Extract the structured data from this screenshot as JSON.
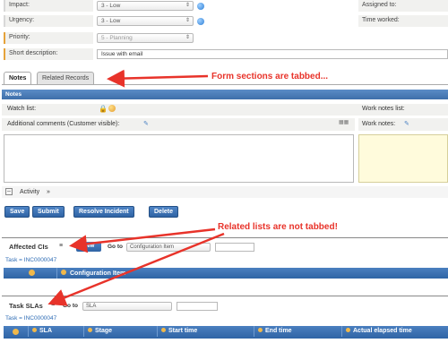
{
  "form": {
    "impact": {
      "label": "Impact:",
      "value": "3 - Low"
    },
    "urgency": {
      "label": "Urgency:",
      "value": "3 - Low"
    },
    "priority": {
      "label": "Priority:",
      "value": "5 - Planning"
    },
    "short_description": {
      "label": "Short description:",
      "value": "Issue with email"
    },
    "assigned_to": {
      "label": "Assigned to:"
    },
    "time_worked": {
      "label": "Time worked:"
    }
  },
  "tabs": [
    {
      "label": "Notes"
    },
    {
      "label": "Related Records"
    }
  ],
  "notes_section": {
    "header": "Notes",
    "watch_list_label": "Watch list:",
    "additional_comments_label": "Additional comments (Customer visible):",
    "work_notes_list_label": "Work notes list:",
    "work_notes_label": "Work notes:"
  },
  "activity": {
    "label": "Activity",
    "chevron": "»"
  },
  "buttons": {
    "save": "Save",
    "submit": "Submit",
    "resolve": "Resolve Incident",
    "delete": "Delete"
  },
  "annotations": {
    "tabbed": "Form sections are tabbed...",
    "not_tabbed": "Related lists are not tabbed!"
  },
  "affected_cis": {
    "title": "Affected CIs",
    "new_button": "New",
    "goto_label": "Go to",
    "goto_value": "Configuration Item",
    "breadcrumb": "Task = INC0000047",
    "column": "Configuration Item"
  },
  "task_slas": {
    "title": "Task SLAs",
    "goto_label": "Go to",
    "goto_value": "SLA",
    "breadcrumb": "Task = INC0000047",
    "columns": [
      "SLA",
      "Stage",
      "Start time",
      "End time",
      "Actual elapsed time"
    ]
  },
  "colors": {
    "accent": "#3e6faa",
    "annotation": "#e8332a",
    "mandatory": "#e5a23a",
    "work_notes_bg": "#fffbdc"
  }
}
